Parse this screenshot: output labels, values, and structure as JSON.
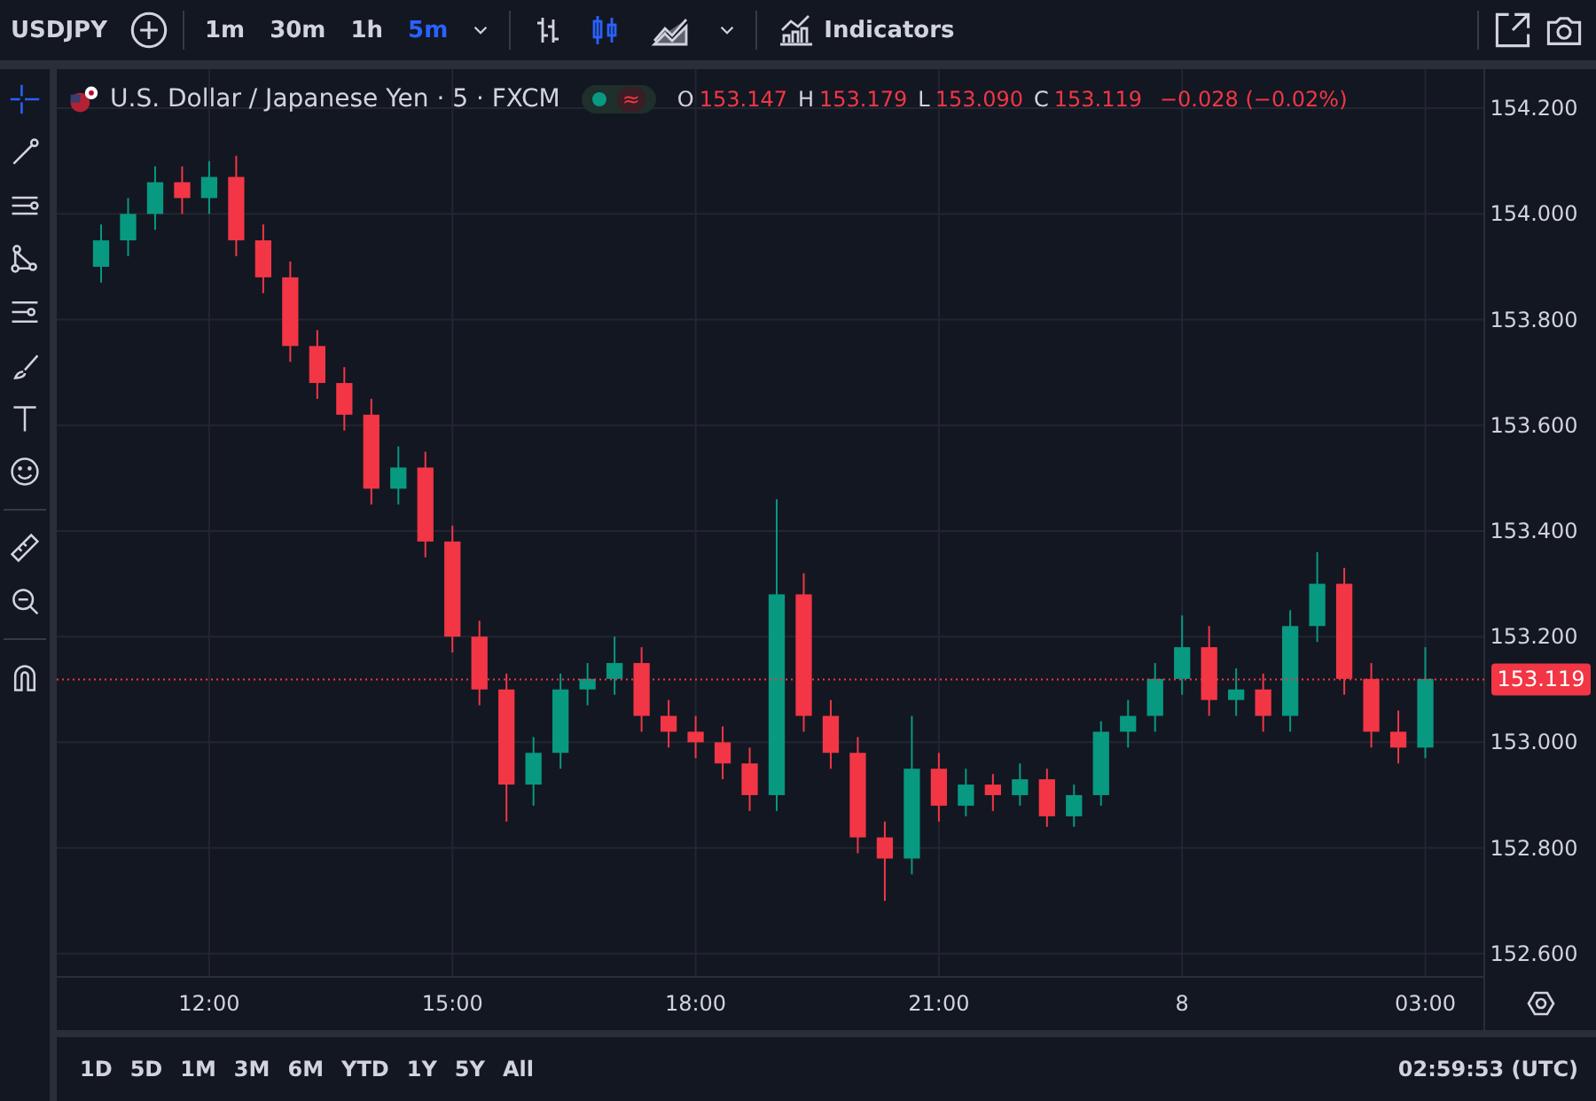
{
  "toolbar": {
    "symbol": "USDJPY",
    "intervals": [
      {
        "label": "1m",
        "selected": false
      },
      {
        "label": "30m",
        "selected": false
      },
      {
        "label": "1h",
        "selected": false
      },
      {
        "label": "5m",
        "selected": true
      }
    ],
    "chart_styles": [
      {
        "kind": "bars",
        "selected": false
      },
      {
        "kind": "candles",
        "selected": true
      },
      {
        "kind": "area",
        "selected": false
      }
    ],
    "indicators_label": "Indicators"
  },
  "legend": {
    "title": "U.S. Dollar / Japanese Yen · 5 · FXCM",
    "status_glyph": "≈",
    "ohlc": [
      {
        "key": "O",
        "value": "153.147"
      },
      {
        "key": "H",
        "value": "153.179"
      },
      {
        "key": "L",
        "value": "153.090"
      },
      {
        "key": "C",
        "value": "153.119"
      }
    ],
    "change": "−0.028 (−0.02%)"
  },
  "chart": {
    "chart_data": {
      "type": "candlestick",
      "ylim": [
        152.556,
        154.274
      ],
      "grid": true,
      "ref_lines": [
        {
          "axis": "y",
          "value": 153.119,
          "label": "153.119",
          "color": "#f23645"
        }
      ],
      "categories": [
        null,
        null,
        null,
        null,
        "12:00",
        null,
        null,
        null,
        null,
        null,
        null,
        null,
        null,
        "15:00",
        null,
        null,
        null,
        null,
        null,
        null,
        null,
        null,
        "18:00",
        null,
        null,
        null,
        null,
        null,
        null,
        null,
        null,
        "21:00",
        null,
        null,
        null,
        null,
        null,
        null,
        null,
        null,
        "8",
        null,
        null,
        null,
        null,
        null,
        null,
        null,
        null,
        "03:00"
      ],
      "yticks": [
        {
          "value": 152.6,
          "label": "152.600"
        },
        {
          "value": 152.8,
          "label": "152.800"
        },
        {
          "value": 153.0,
          "label": "153.000"
        },
        {
          "value": 153.2,
          "label": "153.200"
        },
        {
          "value": 153.4,
          "label": "153.400"
        },
        {
          "value": 153.6,
          "label": "153.600"
        },
        {
          "value": 153.8,
          "label": "153.800"
        },
        {
          "value": 154.0,
          "label": "154.000"
        },
        {
          "value": 154.2,
          "label": "154.200"
        }
      ],
      "ohlc": [
        [
          153.9,
          153.98,
          153.87,
          153.95
        ],
        [
          153.95,
          154.03,
          153.92,
          154.0
        ],
        [
          154.0,
          154.09,
          153.97,
          154.06
        ],
        [
          154.06,
          154.09,
          154.0,
          154.03
        ],
        [
          154.03,
          154.1,
          154.0,
          154.07
        ],
        [
          154.07,
          154.11,
          153.92,
          153.95
        ],
        [
          153.95,
          153.98,
          153.85,
          153.88
        ],
        [
          153.88,
          153.91,
          153.72,
          153.75
        ],
        [
          153.75,
          153.78,
          153.65,
          153.68
        ],
        [
          153.68,
          153.71,
          153.59,
          153.62
        ],
        [
          153.62,
          153.65,
          153.45,
          153.48
        ],
        [
          153.48,
          153.56,
          153.45,
          153.52
        ],
        [
          153.52,
          153.55,
          153.35,
          153.38
        ],
        [
          153.38,
          153.41,
          153.17,
          153.2
        ],
        [
          153.2,
          153.23,
          153.07,
          153.1
        ],
        [
          153.1,
          153.13,
          152.85,
          152.92
        ],
        [
          152.92,
          153.01,
          152.88,
          152.98
        ],
        [
          152.98,
          153.13,
          152.95,
          153.1
        ],
        [
          153.1,
          153.15,
          153.07,
          153.12
        ],
        [
          153.12,
          153.2,
          153.09,
          153.15
        ],
        [
          153.15,
          153.18,
          153.02,
          153.05
        ],
        [
          153.05,
          153.08,
          152.99,
          153.02
        ],
        [
          153.02,
          153.05,
          152.97,
          153.0
        ],
        [
          153.0,
          153.03,
          152.93,
          152.96
        ],
        [
          152.96,
          152.99,
          152.87,
          152.9
        ],
        [
          152.9,
          153.46,
          152.87,
          153.28
        ],
        [
          153.28,
          153.32,
          153.02,
          153.05
        ],
        [
          153.05,
          153.08,
          152.95,
          152.98
        ],
        [
          152.98,
          153.01,
          152.79,
          152.82
        ],
        [
          152.82,
          152.85,
          152.7,
          152.78
        ],
        [
          152.78,
          153.05,
          152.75,
          152.95
        ],
        [
          152.95,
          152.98,
          152.85,
          152.88
        ],
        [
          152.88,
          152.95,
          152.86,
          152.92
        ],
        [
          152.92,
          152.94,
          152.87,
          152.9
        ],
        [
          152.9,
          152.96,
          152.88,
          152.93
        ],
        [
          152.93,
          152.95,
          152.84,
          152.86
        ],
        [
          152.86,
          152.92,
          152.84,
          152.9
        ],
        [
          152.9,
          153.04,
          152.88,
          153.02
        ],
        [
          153.02,
          153.08,
          152.99,
          153.05
        ],
        [
          153.05,
          153.15,
          153.02,
          153.12
        ],
        [
          153.12,
          153.24,
          153.09,
          153.18
        ],
        [
          153.18,
          153.22,
          153.05,
          153.08
        ],
        [
          153.08,
          153.14,
          153.05,
          153.1
        ],
        [
          153.1,
          153.13,
          153.02,
          153.05
        ],
        [
          153.05,
          153.25,
          153.02,
          153.22
        ],
        [
          153.22,
          153.36,
          153.19,
          153.3
        ],
        [
          153.3,
          153.33,
          153.09,
          153.12
        ],
        [
          153.12,
          153.15,
          152.99,
          153.02
        ],
        [
          153.02,
          153.06,
          152.96,
          152.99
        ],
        [
          152.99,
          153.18,
          152.97,
          153.12
        ]
      ]
    }
  },
  "ranges": [
    "1D",
    "5D",
    "1M",
    "3M",
    "6M",
    "YTD",
    "1Y",
    "5Y",
    "All"
  ],
  "clock": "02:59:53 (UTC)"
}
